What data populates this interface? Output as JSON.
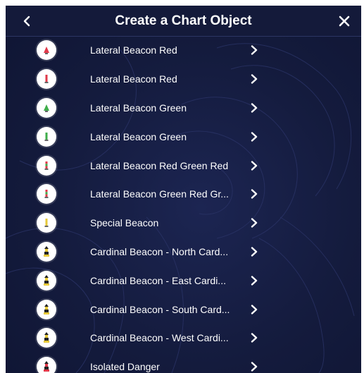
{
  "header": {
    "title": "Create a Chart Object"
  },
  "items": [
    {
      "label": "Lateral Beacon Red",
      "icon": "beacon-red-icon",
      "color": "#e0394a",
      "kind": "cone"
    },
    {
      "label": "Lateral Beacon Red",
      "icon": "beacon-red-icon",
      "color": "#e0394a",
      "kind": "pole"
    },
    {
      "label": "Lateral Beacon Green",
      "icon": "beacon-green-icon",
      "color": "#3fae4a",
      "kind": "cone"
    },
    {
      "label": "Lateral Beacon Green",
      "icon": "beacon-green-icon",
      "color": "#3fae4a",
      "kind": "pole"
    },
    {
      "label": "Lateral Beacon Red Green Red",
      "icon": "beacon-red-green-red-icon",
      "color": "#e0394a",
      "kind": "stack"
    },
    {
      "label": "Lateral Beacon Green Red Gr...",
      "icon": "beacon-green-red-green-icon",
      "color": "#3fae4a",
      "kind": "stack"
    },
    {
      "label": "Special Beacon",
      "icon": "beacon-yellow-icon",
      "color": "#e6c93a",
      "kind": "pole"
    },
    {
      "label": "Cardinal Beacon - North Card...",
      "icon": "cardinal-beacon-icon",
      "color": "#e6c93a",
      "kind": "cardinal"
    },
    {
      "label": "Cardinal Beacon - East Cardi...",
      "icon": "cardinal-beacon-icon",
      "color": "#e6c93a",
      "kind": "cardinal"
    },
    {
      "label": "Cardinal Beacon - South Card...",
      "icon": "cardinal-beacon-icon",
      "color": "#e6c93a",
      "kind": "cardinal"
    },
    {
      "label": "Cardinal Beacon - West Cardi...",
      "icon": "cardinal-beacon-icon",
      "color": "#e6c93a",
      "kind": "cardinal"
    },
    {
      "label": "Isolated Danger",
      "icon": "isolated-danger-icon",
      "color": "#e0394a",
      "kind": "cardinal"
    }
  ]
}
